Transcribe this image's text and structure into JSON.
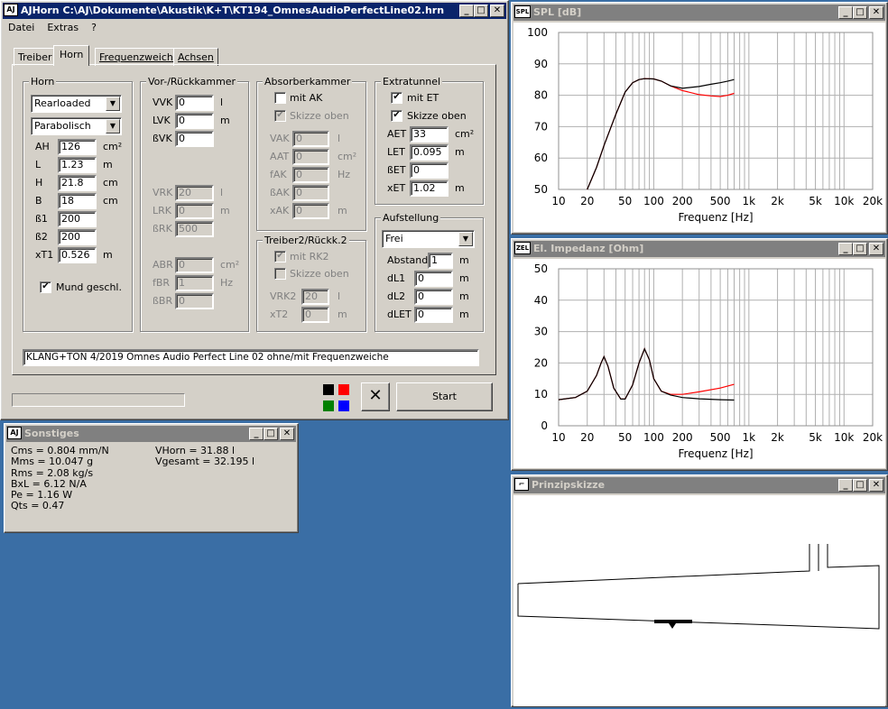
{
  "main": {
    "icon": "AJ",
    "title": "AJHorn  C:\\AJ\\Dokumente\\Akustik\\K+T\\KT194_OmnesAudioPerfectLine02.hrn",
    "menu": [
      "Datei",
      "Extras",
      "?"
    ],
    "tabs": [
      "Treiber",
      "Horn",
      "Frequenzweiche",
      "Achsen"
    ],
    "horn": {
      "group": "Horn",
      "type": "Rearloaded",
      "profile": "Parabolisch",
      "fields": [
        {
          "label": "AH",
          "value": "126",
          "unit": "cm²"
        },
        {
          "label": "L",
          "value": "1.23",
          "unit": "m"
        },
        {
          "label": "H",
          "value": "21.8",
          "unit": "cm"
        },
        {
          "label": "B",
          "value": "18",
          "unit": "cm"
        },
        {
          "label": "ß1",
          "value": "200",
          "unit": ""
        },
        {
          "label": "ß2",
          "value": "200",
          "unit": ""
        },
        {
          "label": "xT1",
          "value": "0.526",
          "unit": "m"
        }
      ],
      "mund_label": "Mund geschl.",
      "mund_checked": "✔"
    },
    "vor": {
      "group": "Vor-/Rückkammer",
      "fields": [
        {
          "label": "VVK",
          "value": "0",
          "unit": "l"
        },
        {
          "label": "LVK",
          "value": "0",
          "unit": "m"
        },
        {
          "label": "ßVK",
          "value": "0",
          "unit": ""
        }
      ],
      "rk": [
        {
          "label": "VRK",
          "value": "20",
          "unit": "l"
        },
        {
          "label": "LRK",
          "value": "0",
          "unit": "m"
        },
        {
          "label": "ßRK",
          "value": "500",
          "unit": ""
        }
      ],
      "br": [
        {
          "label": "ABR",
          "value": "0",
          "unit": "cm²"
        },
        {
          "label": "fBR",
          "value": "1",
          "unit": "Hz"
        },
        {
          "label": "ßBR",
          "value": "0",
          "unit": ""
        }
      ]
    },
    "absorber": {
      "group": "Absorberkammer",
      "mit_ak": "mit AK",
      "skizze": "Skizze oben",
      "skizze_checked": "✔",
      "fields": [
        {
          "label": "VAK",
          "value": "0",
          "unit": "l"
        },
        {
          "label": "AAT",
          "value": "0",
          "unit": "cm²"
        },
        {
          "label": "fAK",
          "value": "0",
          "unit": "Hz"
        },
        {
          "label": "ßAK",
          "value": "0",
          "unit": ""
        },
        {
          "label": "xAK",
          "value": "0",
          "unit": "m"
        }
      ]
    },
    "treiber2": {
      "group": "Treiber2/Rückk.2",
      "mit_rk2": "mit RK2",
      "mit_rk2_checked": "✔",
      "skizze": "Skizze oben",
      "fields": [
        {
          "label": "VRK2",
          "value": "20",
          "unit": "l"
        },
        {
          "label": "xT2",
          "value": "0",
          "unit": "m"
        }
      ]
    },
    "extratunnel": {
      "group": "Extratunnel",
      "mit_et": "mit ET",
      "mit_et_checked": "✔",
      "skizze": "Skizze oben",
      "skizze_checked": "✔",
      "fields": [
        {
          "label": "AET",
          "value": "33",
          "unit": "cm²"
        },
        {
          "label": "LET",
          "value": "0.095",
          "unit": "m"
        },
        {
          "label": "ßET",
          "value": "0",
          "unit": ""
        },
        {
          "label": "xET",
          "value": "1.02",
          "unit": "m"
        }
      ]
    },
    "aufstellung": {
      "group": "Aufstellung",
      "mode": "Frei",
      "fields": [
        {
          "label": "Abstand",
          "value": "1",
          "unit": "m"
        },
        {
          "label": "dL1",
          "value": "0",
          "unit": "m"
        },
        {
          "label": "dL2",
          "value": "0",
          "unit": "m"
        },
        {
          "label": "dLET",
          "value": "0",
          "unit": "m"
        }
      ]
    },
    "comment": "KLANG+TON 4/2019 Omnes Audio Perfect Line 02 ohne/mit Frequenzweiche",
    "colors": [
      "#000000",
      "#ff0000",
      "#008000",
      "#0000ff"
    ],
    "start_label": "Start",
    "cancel_glyph": "✕"
  },
  "sonstiges": {
    "title": "Sonstiges",
    "left": [
      "Cms = 0.804 mm/N",
      "Mms = 10.047 g",
      "Rms = 2.08 kg/s",
      "BxL = 6.12 N/A",
      "Pe = 1.16 W",
      "Qts = 0.47"
    ],
    "right": [
      "VHorn = 31.88 l",
      "Vgesamt = 32.195 l"
    ]
  },
  "spl": {
    "icon": "SPL",
    "title": "SPL [dB]",
    "xlabel": "Frequenz [Hz]",
    "xticks": [
      "10",
      "20",
      "50",
      "100",
      "200",
      "500",
      "1k",
      "2k",
      "5k",
      "10k",
      "20k"
    ],
    "yticks": [
      "100",
      "90",
      "80",
      "70",
      "60",
      "50"
    ]
  },
  "imp": {
    "icon": "ZEL",
    "title": "El. Impedanz [Ohm]",
    "xlabel": "Frequenz [Hz]",
    "xticks": [
      "10",
      "20",
      "50",
      "100",
      "200",
      "500",
      "1k",
      "2k",
      "5k",
      "10k",
      "20k"
    ],
    "yticks": [
      "50",
      "40",
      "30",
      "20",
      "10",
      "0"
    ]
  },
  "skizze": {
    "title": "Prinzipskizze"
  },
  "chart_data": [
    {
      "type": "line",
      "title": "SPL [dB]",
      "xlabel": "Frequenz [Hz]",
      "xscale": "log",
      "xlim": [
        10,
        20000
      ],
      "ylim": [
        50,
        100
      ],
      "grid": true,
      "series": [
        {
          "color": "#000000",
          "x": [
            20,
            25,
            30,
            40,
            50,
            60,
            70,
            80,
            100,
            120,
            150,
            200,
            300,
            400,
            500,
            600,
            700
          ],
          "y": [
            50,
            57,
            64,
            74,
            81,
            84,
            85,
            85.3,
            85.2,
            84.5,
            83,
            82.2,
            82.8,
            83.5,
            84,
            84.5,
            85
          ]
        },
        {
          "color": "#ff0000",
          "x": [
            20,
            25,
            30,
            40,
            50,
            60,
            70,
            80,
            100,
            120,
            150,
            200,
            300,
            400,
            500,
            600,
            700
          ],
          "y": [
            50,
            57,
            64,
            74,
            81,
            84,
            85,
            85.3,
            85.2,
            84.5,
            83,
            81.5,
            80.2,
            79.8,
            79.6,
            80,
            80.6
          ]
        }
      ]
    },
    {
      "type": "line",
      "title": "El. Impedanz [Ohm]",
      "xlabel": "Frequenz [Hz]",
      "xscale": "log",
      "xlim": [
        10,
        20000
      ],
      "ylim": [
        0,
        50
      ],
      "grid": true,
      "series": [
        {
          "color": "#000000",
          "x": [
            10,
            15,
            20,
            25,
            28,
            30,
            33,
            38,
            45,
            50,
            60,
            70,
            80,
            90,
            100,
            120,
            150,
            200,
            300,
            500,
            700
          ],
          "y": [
            8.3,
            9,
            11,
            16,
            20,
            22,
            19,
            12,
            8.5,
            8.5,
            13,
            20,
            24.5,
            21,
            15,
            11,
            9.8,
            9,
            8.6,
            8.3,
            8.2
          ]
        },
        {
          "color": "#ff0000",
          "x": [
            10,
            15,
            20,
            25,
            28,
            30,
            33,
            38,
            45,
            50,
            60,
            70,
            80,
            90,
            100,
            120,
            150,
            200,
            300,
            500,
            700
          ],
          "y": [
            8.3,
            9,
            11,
            16,
            20,
            22,
            19,
            12,
            8.5,
            8.5,
            13,
            20,
            24.5,
            21,
            15,
            11,
            10,
            10,
            10.8,
            12,
            13.2
          ]
        }
      ]
    }
  ]
}
